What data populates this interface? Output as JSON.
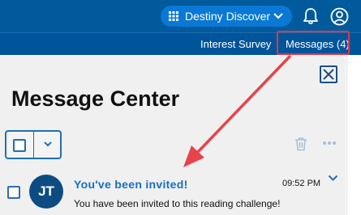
{
  "header": {
    "app_switcher_label": "Destiny Discover"
  },
  "nav": {
    "interest_survey": "Interest Survey",
    "messages": "Messages (4)"
  },
  "panel": {
    "title": "Message Center"
  },
  "messages": [
    {
      "avatar_initials": "JT",
      "title": "You've been invited!",
      "time": "09:52 PM",
      "preview": "You have been invited to this reading challenge!"
    }
  ],
  "colors": {
    "header_bg": "#005a9c",
    "accent": "#0a78d4",
    "highlight": "#e0364a",
    "link": "#1670c2"
  },
  "icons": [
    "grid-icon",
    "chevron-down-icon",
    "bell-icon",
    "user-icon",
    "close-icon",
    "trash-icon",
    "more-icon"
  ]
}
